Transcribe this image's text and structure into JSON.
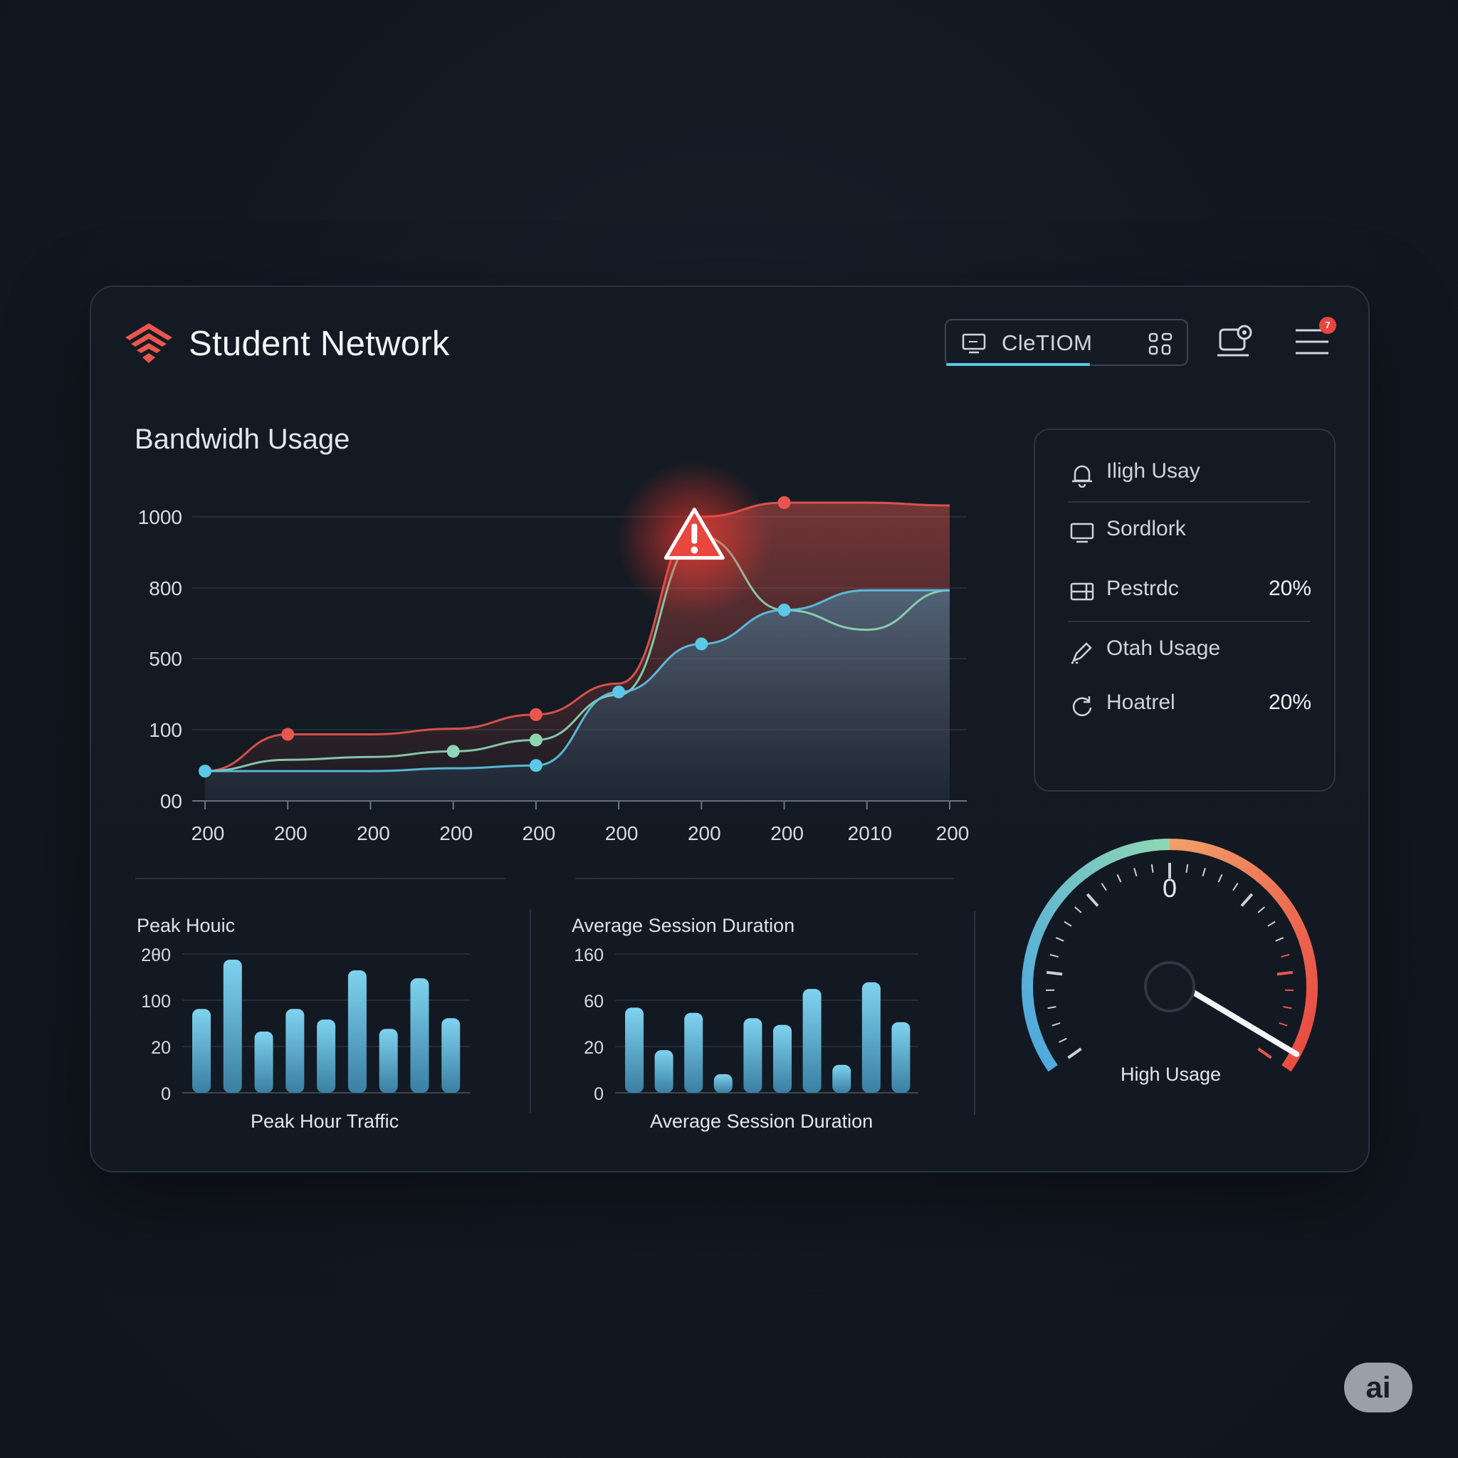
{
  "app": {
    "title": "Student Network"
  },
  "header": {
    "search_text": "CleTIOM",
    "icons": [
      "monitor-icon",
      "grid-icon",
      "device-settings-icon",
      "menu-icon"
    ],
    "notification_count": "7"
  },
  "bandwidth": {
    "title": "Bandwidh Usage"
  },
  "side_card": {
    "items": [
      {
        "label": "Iligh Usay",
        "value": "",
        "icon": "bell-icon"
      },
      {
        "label": "Sordlork",
        "value": "",
        "icon": "monitor-icon"
      },
      {
        "label": "Pestrdc",
        "value": "20%",
        "icon": "display-split-icon"
      },
      {
        "label": "Otah Usage",
        "value": "",
        "icon": "edit-icon"
      },
      {
        "label": "Hoatrel",
        "value": "20%",
        "icon": "refresh-icon"
      }
    ]
  },
  "peak": {
    "title": "Peak Houic",
    "caption": "Peak Hour Traffic"
  },
  "session": {
    "title": "Average Session Duration",
    "caption": "Average Session Duration"
  },
  "gauge": {
    "label": "High Usage",
    "value_text": "0",
    "needle_fraction": 0.98
  },
  "watermark": {
    "text": "ai"
  },
  "colors": {
    "red": "#e8574f",
    "cyan": "#5cc7e6",
    "green": "#8fd7b4",
    "bg": "#131922"
  },
  "chart_data": [
    {
      "type": "area",
      "title": "Bandwidh Usage",
      "y_ticks": [
        "1000",
        "800",
        "500",
        "100",
        "00"
      ],
      "x_ticks": [
        "200",
        "200",
        "200",
        "200",
        "200",
        "200",
        "200",
        "200",
        "2010",
        "200"
      ],
      "series": [
        {
          "color": "#e8574f",
          "values": [
            0.05,
            0.18,
            0.18,
            0.2,
            0.25,
            0.36,
            0.95,
            1.0,
            1.0,
            0.99
          ]
        },
        {
          "color": "#8fd7b4",
          "values": [
            0.05,
            0.09,
            0.1,
            0.12,
            0.16,
            0.32,
            0.88,
            0.62,
            0.55,
            0.69
          ]
        },
        {
          "color": "#5cc7e6",
          "values": [
            0.05,
            0.05,
            0.05,
            0.06,
            0.07,
            0.33,
            0.5,
            0.62,
            0.69,
            0.69
          ]
        }
      ],
      "alert_index": 6
    },
    {
      "type": "bar",
      "title": "Peak Houic",
      "y_ticks": [
        "2θ0",
        "100",
        "20",
        "0"
      ],
      "values": [
        0.63,
        1.0,
        0.46,
        0.63,
        0.55,
        0.92,
        0.48,
        0.86,
        0.56
      ]
    },
    {
      "type": "bar",
      "title": "Average Session Duration",
      "y_ticks": [
        "160",
        "60",
        "20",
        "0"
      ],
      "values": [
        0.64,
        0.32,
        0.6,
        0.14,
        0.56,
        0.51,
        0.78,
        0.21,
        0.83,
        0.53
      ]
    }
  ]
}
